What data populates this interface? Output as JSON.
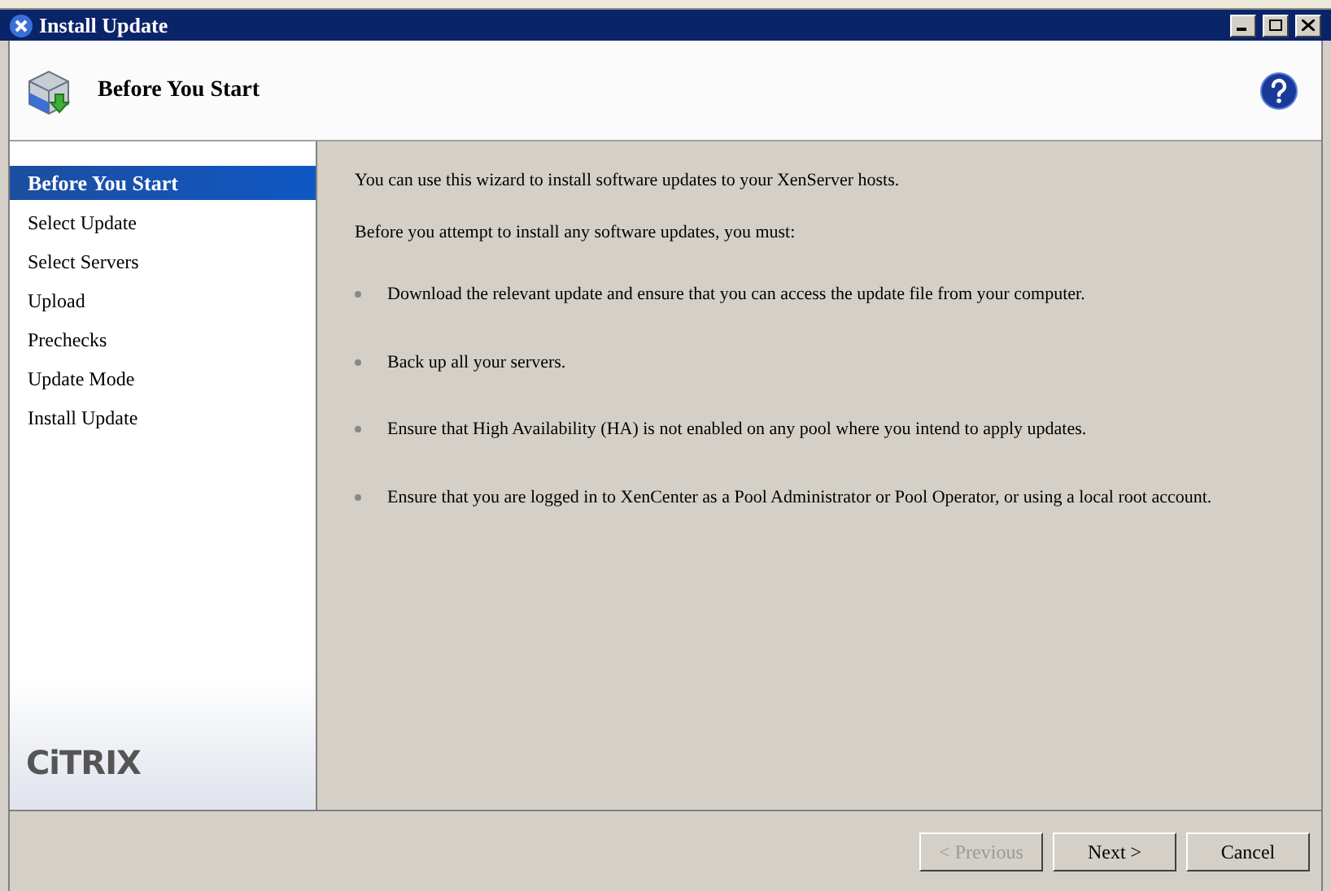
{
  "window": {
    "title": "Install Update"
  },
  "header": {
    "title": "Before You Start"
  },
  "steps": [
    {
      "label": "Before You Start",
      "selected": true
    },
    {
      "label": "Select Update",
      "selected": false
    },
    {
      "label": "Select Servers",
      "selected": false
    },
    {
      "label": "Upload",
      "selected": false
    },
    {
      "label": "Prechecks",
      "selected": false
    },
    {
      "label": "Update Mode",
      "selected": false
    },
    {
      "label": "Install Update",
      "selected": false
    }
  ],
  "logo": "CiTRIX",
  "content": {
    "intro": "You can use this wizard to install software updates to your XenServer hosts.",
    "lead": "Before you attempt to install any software updates, you must:",
    "bullets": [
      "Download the relevant update and ensure that you can access the update file from your computer.",
      "Back up all your servers.",
      "Ensure that High Availability (HA) is not enabled on any pool where you intend to apply updates.",
      "Ensure that you are logged in to XenCenter as a Pool Administrator or Pool Operator, or using a local root account."
    ]
  },
  "buttons": [
    {
      "label": "< Previous",
      "disabled": true
    },
    {
      "label": "Next >",
      "disabled": false
    },
    {
      "label": "Cancel",
      "disabled": false
    }
  ]
}
